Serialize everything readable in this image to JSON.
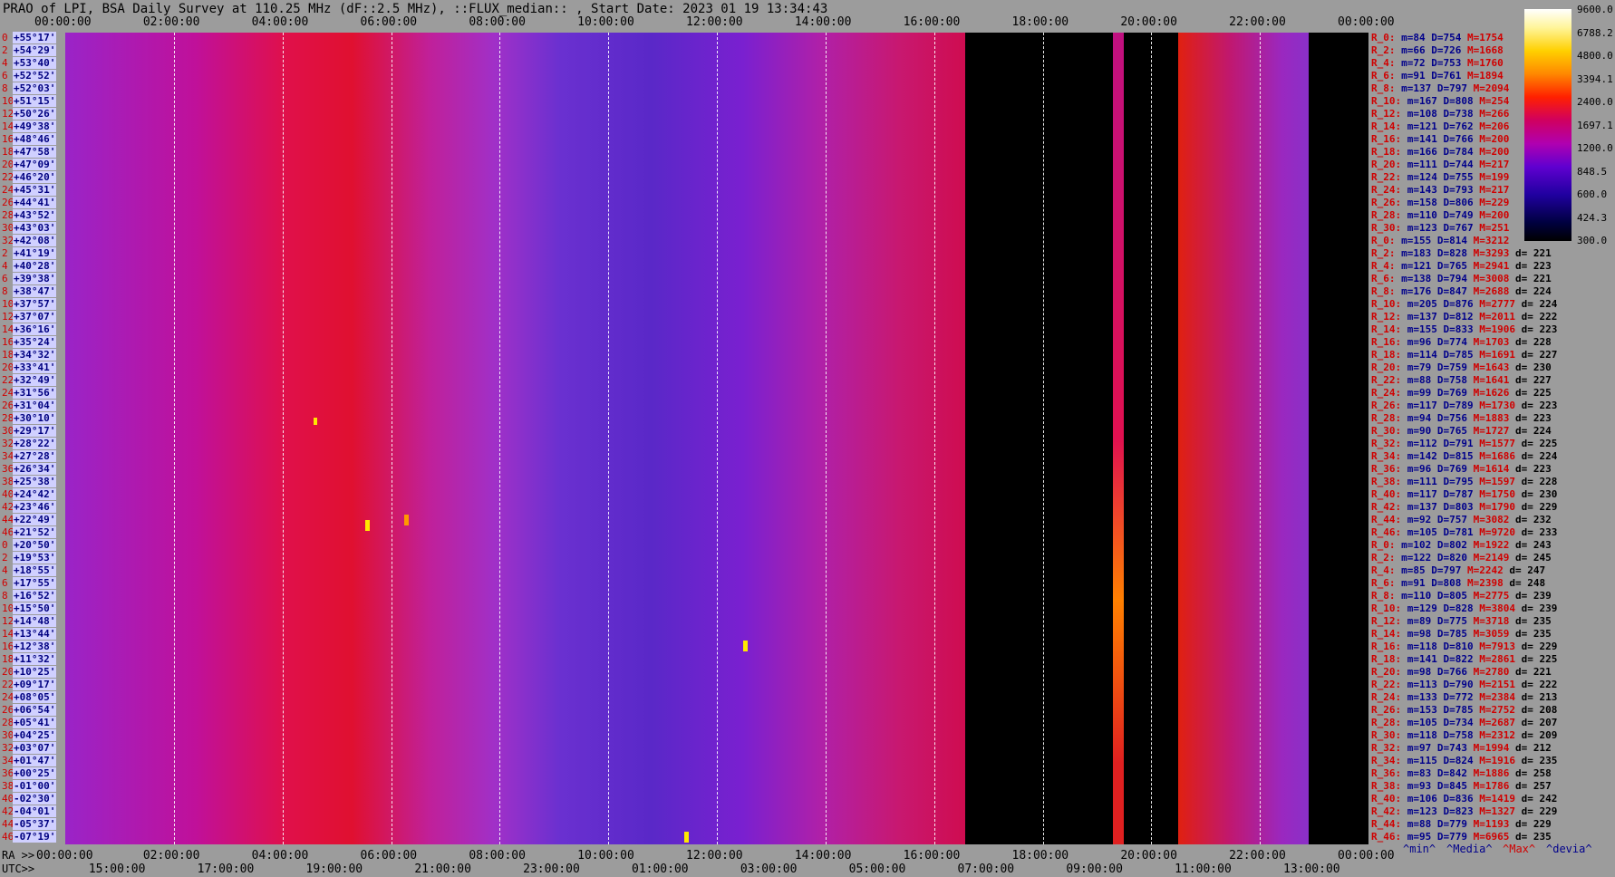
{
  "title": "PRAO of LPI, BSA Daily Survey at 110.25 MHz (dF::2.5 MHz), ::FLUX_median:: , Start Date: 2023 01 19 13:34:43",
  "top_ticks": [
    "00:00:00",
    "02:00:00",
    "04:00:00",
    "06:00:00",
    "08:00:00",
    "10:00:00",
    "12:00:00",
    "14:00:00",
    "16:00:00",
    "18:00:00",
    "20:00:00",
    "22:00:00",
    "00:00:00"
  ],
  "bottom_ra_ticks": [
    "00:00:00",
    "02:00:00",
    "04:00:00",
    "06:00:00",
    "08:00:00",
    "10:00:00",
    "12:00:00",
    "14:00:00",
    "16:00:00",
    "18:00:00",
    "20:00:00",
    "22:00:00",
    "00:00:00"
  ],
  "bottom_utc_ticks": [
    "15:00:00",
    "17:00:00",
    "19:00:00",
    "21:00:00",
    "23:00:00",
    "01:00:00",
    "03:00:00",
    "05:00:00",
    "07:00:00",
    "09:00:00",
    "11:00:00",
    "13:00:00"
  ],
  "ra_label": "RA >>",
  "utc_label": "UTC>>",
  "colorbar": [
    "9600.0",
    "6788.2",
    "4800.0",
    "3394.1",
    "2400.0",
    "1697.1",
    "1200.0",
    "848.5",
    "600.0",
    "424.3",
    "300.0"
  ],
  "footer": [
    "^min^",
    "^Media^",
    "^Max^",
    "^devia^"
  ],
  "declinations": [
    [
      "0",
      "+55°17'"
    ],
    [
      "2",
      "+54°29'"
    ],
    [
      "4",
      "+53°40'"
    ],
    [
      "6",
      "+52°52'"
    ],
    [
      "8",
      "+52°03'"
    ],
    [
      "10",
      "+51°15'"
    ],
    [
      "12",
      "+50°26'"
    ],
    [
      "14",
      "+49°38'"
    ],
    [
      "16",
      "+48°46'"
    ],
    [
      "18",
      "+47°58'"
    ],
    [
      "20",
      "+47°09'"
    ],
    [
      "22",
      "+46°20'"
    ],
    [
      "24",
      "+45°31'"
    ],
    [
      "26",
      "+44°41'"
    ],
    [
      "28",
      "+43°52'"
    ],
    [
      "30",
      "+43°03'"
    ],
    [
      "32",
      "+42°08'"
    ],
    [
      "2",
      "+41°19'"
    ],
    [
      "4",
      "+40°28'"
    ],
    [
      "6",
      "+39°38'"
    ],
    [
      "8",
      "+38°47'"
    ],
    [
      "10",
      "+37°57'"
    ],
    [
      "12",
      "+37°07'"
    ],
    [
      "14",
      "+36°16'"
    ],
    [
      "16",
      "+35°24'"
    ],
    [
      "18",
      "+34°32'"
    ],
    [
      "20",
      "+33°41'"
    ],
    [
      "22",
      "+32°49'"
    ],
    [
      "24",
      "+31°56'"
    ],
    [
      "26",
      "+31°04'"
    ],
    [
      "28",
      "+30°10'"
    ],
    [
      "30",
      "+29°17'"
    ],
    [
      "32",
      "+28°22'"
    ],
    [
      "34",
      "+27°28'"
    ],
    [
      "36",
      "+26°34'"
    ],
    [
      "38",
      "+25°38'"
    ],
    [
      "40",
      "+24°42'"
    ],
    [
      "42",
      "+23°46'"
    ],
    [
      "44",
      "+22°49'"
    ],
    [
      "46",
      "+21°52'"
    ],
    [
      "0",
      "+20°50'"
    ],
    [
      "2",
      "+19°53'"
    ],
    [
      "4",
      "+18°55'"
    ],
    [
      "6",
      "+17°55'"
    ],
    [
      "8",
      "+16°52'"
    ],
    [
      "10",
      "+15°50'"
    ],
    [
      "12",
      "+14°48'"
    ],
    [
      "14",
      "+13°44'"
    ],
    [
      "16",
      "+12°38'"
    ],
    [
      "18",
      "+11°32'"
    ],
    [
      "20",
      "+10°25'"
    ],
    [
      "22",
      "+09°17'"
    ],
    [
      "24",
      "+08°05'"
    ],
    [
      "26",
      "+06°54'"
    ],
    [
      "28",
      "+05°41'"
    ],
    [
      "30",
      "+04°25'"
    ],
    [
      "32",
      "+03°07'"
    ],
    [
      "34",
      "+01°47'"
    ],
    [
      "36",
      "+00°25'"
    ],
    [
      "38",
      "-01°00'"
    ],
    [
      "40",
      "-02°30'"
    ],
    [
      "42",
      "-04°01'"
    ],
    [
      "44",
      "-05°37'"
    ],
    [
      "46",
      "-07°19'"
    ]
  ],
  "stats": [
    [
      "R_0:",
      "m=84",
      "D=754",
      "M=1754",
      ""
    ],
    [
      "R_2:",
      "m=66",
      "D=726",
      "M=1668",
      ""
    ],
    [
      "R_4:",
      "m=72",
      "D=753",
      "M=1760",
      ""
    ],
    [
      "R_6:",
      "m=91",
      "D=761",
      "M=1894",
      ""
    ],
    [
      "R_8:",
      "m=137",
      "D=797",
      "M=2094",
      ""
    ],
    [
      "R_10:",
      "m=167",
      "D=808",
      "M=254",
      ""
    ],
    [
      "R_12:",
      "m=108",
      "D=738",
      "M=266",
      ""
    ],
    [
      "R_14:",
      "m=121",
      "D=762",
      "M=206",
      ""
    ],
    [
      "R_16:",
      "m=141",
      "D=766",
      "M=200",
      ""
    ],
    [
      "R_18:",
      "m=166",
      "D=784",
      "M=200",
      ""
    ],
    [
      "R_20:",
      "m=111",
      "D=744",
      "M=217",
      ""
    ],
    [
      "R_22:",
      "m=124",
      "D=755",
      "M=199",
      ""
    ],
    [
      "R_24:",
      "m=143",
      "D=793",
      "M=217",
      ""
    ],
    [
      "R_26:",
      "m=158",
      "D=806",
      "M=229",
      ""
    ],
    [
      "R_28:",
      "m=110",
      "D=749",
      "M=200",
      ""
    ],
    [
      "R_30:",
      "m=123",
      "D=767",
      "M=251",
      ""
    ],
    [
      "R_0:",
      "m=155",
      "D=814",
      "M=3212",
      ""
    ],
    [
      "R_2:",
      "m=183",
      "D=828",
      "M=3293",
      "d= 221"
    ],
    [
      "R_4:",
      "m=121",
      "D=765",
      "M=2941",
      "d= 223"
    ],
    [
      "R_6:",
      "m=138",
      "D=794",
      "M=3008",
      "d= 221"
    ],
    [
      "R_8:",
      "m=176",
      "D=847",
      "M=2688",
      "d= 224"
    ],
    [
      "R_10:",
      "m=205",
      "D=876",
      "M=2777",
      "d= 224"
    ],
    [
      "R_12:",
      "m=137",
      "D=812",
      "M=2011",
      "d= 222"
    ],
    [
      "R_14:",
      "m=155",
      "D=833",
      "M=1906",
      "d= 223"
    ],
    [
      "R_16:",
      "m=96",
      "D=774",
      "M=1703",
      "d= 228"
    ],
    [
      "R_18:",
      "m=114",
      "D=785",
      "M=1691",
      "d= 227"
    ],
    [
      "R_20:",
      "m=79",
      "D=759",
      "M=1643",
      "d= 230"
    ],
    [
      "R_22:",
      "m=88",
      "D=758",
      "M=1641",
      "d= 227"
    ],
    [
      "R_24:",
      "m=99",
      "D=769",
      "M=1626",
      "d= 225"
    ],
    [
      "R_26:",
      "m=117",
      "D=789",
      "M=1730",
      "d= 223"
    ],
    [
      "R_28:",
      "m=94",
      "D=756",
      "M=1883",
      "d= 223"
    ],
    [
      "R_30:",
      "m=90",
      "D=765",
      "M=1727",
      "d= 224"
    ],
    [
      "R_32:",
      "m=112",
      "D=791",
      "M=1577",
      "d= 225"
    ],
    [
      "R_34:",
      "m=142",
      "D=815",
      "M=1686",
      "d= 224"
    ],
    [
      "R_36:",
      "m=96",
      "D=769",
      "M=1614",
      "d= 223"
    ],
    [
      "R_38:",
      "m=111",
      "D=795",
      "M=1597",
      "d= 228"
    ],
    [
      "R_40:",
      "m=117",
      "D=787",
      "M=1750",
      "d= 230"
    ],
    [
      "R_42:",
      "m=137",
      "D=803",
      "M=1790",
      "d= 229"
    ],
    [
      "R_44:",
      "m=92",
      "D=757",
      "M=3082",
      "d= 232"
    ],
    [
      "R_46:",
      "m=105",
      "D=781",
      "M=9720",
      "d= 233"
    ],
    [
      "R_0:",
      "m=102",
      "D=802",
      "M=1922",
      "d= 243"
    ],
    [
      "R_2:",
      "m=122",
      "D=820",
      "M=2149",
      "d= 245"
    ],
    [
      "R_4:",
      "m=85",
      "D=797",
      "M=2242",
      "d= 247"
    ],
    [
      "R_6:",
      "m=91",
      "D=808",
      "M=2398",
      "d= 248"
    ],
    [
      "R_8:",
      "m=110",
      "D=805",
      "M=2775",
      "d= 239"
    ],
    [
      "R_10:",
      "m=129",
      "D=828",
      "M=3804",
      "d= 239"
    ],
    [
      "R_12:",
      "m=89",
      "D=775",
      "M=3718",
      "d= 235"
    ],
    [
      "R_14:",
      "m=98",
      "D=785",
      "M=3059",
      "d= 235"
    ],
    [
      "R_16:",
      "m=118",
      "D=810",
      "M=7913",
      "d= 229"
    ],
    [
      "R_18:",
      "m=141",
      "D=822",
      "M=2861",
      "d= 225"
    ],
    [
      "R_20:",
      "m=98",
      "D=766",
      "M=2780",
      "d= 221"
    ],
    [
      "R_22:",
      "m=113",
      "D=790",
      "M=2151",
      "d= 222"
    ],
    [
      "R_24:",
      "m=133",
      "D=772",
      "M=2384",
      "d= 213"
    ],
    [
      "R_26:",
      "m=153",
      "D=785",
      "M=2752",
      "d= 208"
    ],
    [
      "R_28:",
      "m=105",
      "D=734",
      "M=2687",
      "d= 207"
    ],
    [
      "R_30:",
      "m=118",
      "D=758",
      "M=2312",
      "d= 209"
    ],
    [
      "R_32:",
      "m=97",
      "D=743",
      "M=1994",
      "d= 212"
    ],
    [
      "R_34:",
      "m=115",
      "D=824",
      "M=1916",
      "d= 235"
    ],
    [
      "R_36:",
      "m=83",
      "D=842",
      "M=1886",
      "d= 258"
    ],
    [
      "R_38:",
      "m=93",
      "D=845",
      "M=1786",
      "d= 257"
    ],
    [
      "R_40:",
      "m=106",
      "D=836",
      "M=1419",
      "d= 242"
    ],
    [
      "R_42:",
      "m=123",
      "D=823",
      "M=1327",
      "d= 229"
    ],
    [
      "R_44:",
      "m=88",
      "D=779",
      "M=1193",
      "d= 229"
    ],
    [
      "R_46:",
      "m=95",
      "D=779",
      "M=6965",
      "d= 235"
    ]
  ],
  "chart_data": {
    "type": "heatmap",
    "title": "PRAO of LPI, BSA Daily Survey at 110.25 MHz (dF::2.5 MHz), ::FLUX_median:: , Start Date: 2023 01 19 13:34:43",
    "x_ra_ticks": [
      "00:00:00",
      "02:00:00",
      "04:00:00",
      "06:00:00",
      "08:00:00",
      "10:00:00",
      "12:00:00",
      "14:00:00",
      "16:00:00",
      "18:00:00",
      "20:00:00",
      "22:00:00",
      "00:00:00"
    ],
    "x_utc_ticks": [
      "15:00:00",
      "17:00:00",
      "19:00:00",
      "21:00:00",
      "23:00:00",
      "01:00:00",
      "03:00:00",
      "05:00:00",
      "07:00:00",
      "09:00:00",
      "11:00:00",
      "13:00:00"
    ],
    "colorbar_levels": [
      9600.0,
      6788.2,
      4800.0,
      3394.1,
      2400.0,
      1697.1,
      1200.0,
      848.5,
      600.0,
      424.3,
      300.0
    ],
    "grid": true
  }
}
